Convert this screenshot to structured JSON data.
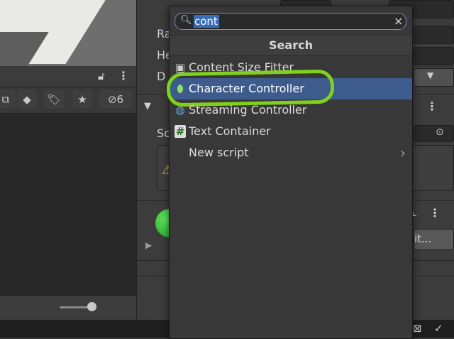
{
  "left_panel": {
    "toolbar_badge": "6"
  },
  "inspector": {
    "label_ra": "Ra",
    "label_he": "He",
    "label_d": "D",
    "label_sc": "Sc",
    "button_it": "it..."
  },
  "popup": {
    "search": {
      "value": "cont",
      "clear_label": "×"
    },
    "title": "Search",
    "results": [
      {
        "label": "Content Size Fitter",
        "icon": "content-size-fitter-icon"
      },
      {
        "label": "Character Controller",
        "icon": "character-controller-icon",
        "selected": true
      },
      {
        "label": "Streaming Controller",
        "icon": "streaming-controller-icon"
      },
      {
        "label": "Text Container",
        "icon": "script-hash-icon"
      },
      {
        "label": "New script",
        "icon": ""
      }
    ],
    "new_script_arrow": "›"
  },
  "colors": {
    "selection": "#3d5b8c",
    "highlight_ring": "#7fd11c",
    "search_focus": "#6b8fc4"
  }
}
